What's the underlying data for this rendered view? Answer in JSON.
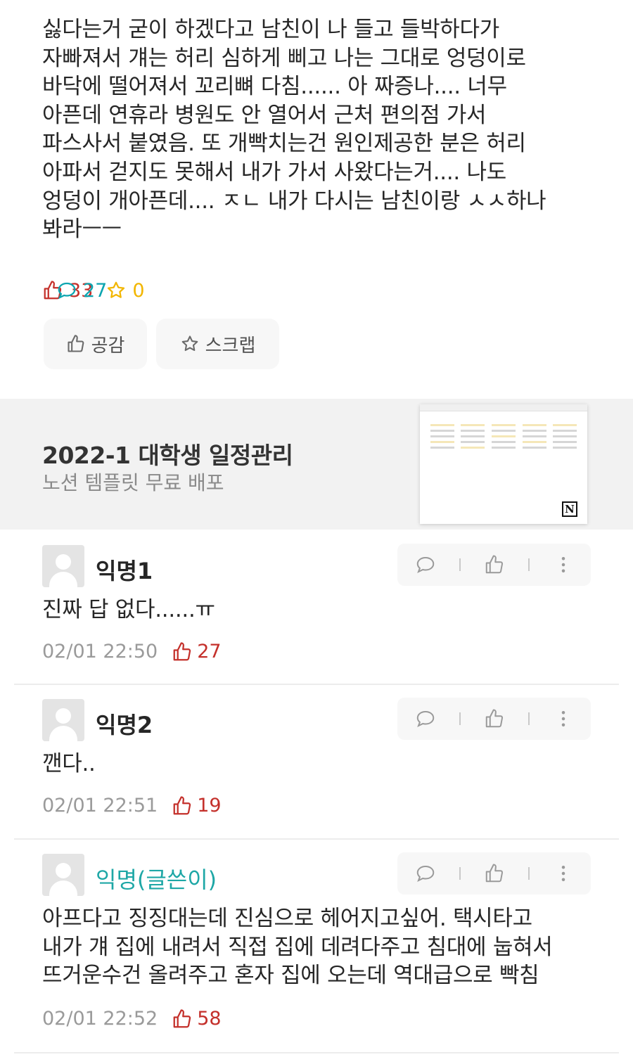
{
  "post": {
    "body": "싫다는거 굳이 하겠다고 남친이 나 들고 들박하다가\n자빠져서 걔는 허리 심하게 삐고 나는 그대로 엉덩이로\n바닥에 떨어져서 꼬리뼈 다침...... 아 짜증나.... 너무\n아픈데 연휴라 병원도 안 열어서 근처 편의점 가서\n파스사서 붙였음. 또 개빡치는건 원인제공한 분은 허리\n아파서 걷지도 못해서 내가 가서 사왔다는거.... 나도\n엉덩이 개아픈데.... ㅈㄴ 내가 다시는 남친이랑 ㅅㅅ하나\n봐라ㅡㅡ",
    "like_count": "33",
    "comment_count": "27",
    "scrap_count": "0",
    "like_button": "공감",
    "scrap_button": "스크랩"
  },
  "ad": {
    "title": "2022-1 대학생 일정관리",
    "subtitle": "노션 템플릿 무료 배포",
    "thumb_badge": "N"
  },
  "comments": [
    {
      "nickname": "익명1",
      "text": "진짜 답 없다......ㅠ",
      "time": "02/01 22:50",
      "likes": "27"
    },
    {
      "nickname": "익명2",
      "text": "깬다..",
      "time": "02/01 22:51",
      "likes": "19"
    },
    {
      "nickname": "익명(글쓴이)",
      "text": "아프다고 징징대는데 진심으로 헤어지고싶어. 택시타고\n내가 걔 집에 내려서 직접 집에 데려다주고 침대에 눕혀서\n뜨거운수건 올려주고 혼자 집에 오는데 역대급으로 빡침",
      "time": "02/01 22:52",
      "likes": "58"
    }
  ],
  "colors": {
    "like": "#c4302b",
    "comment": "#0ca5b0",
    "scrap": "#f2b600",
    "author": "#1ea7a6"
  },
  "icons": {
    "like": "thumbs-up-icon",
    "comment": "speech-bubble-icon",
    "scrap": "star-icon",
    "more": "more-vertical-icon"
  }
}
